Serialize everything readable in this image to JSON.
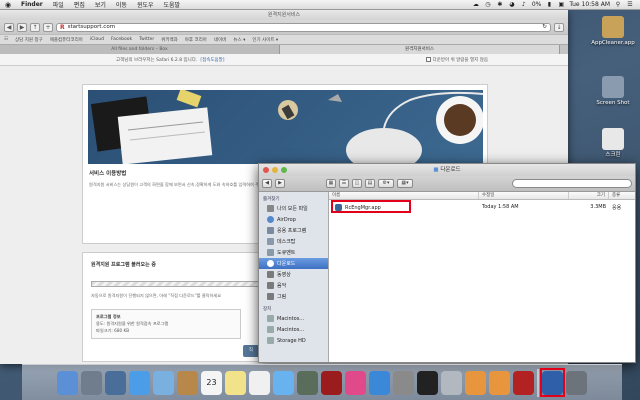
{
  "menubar": {
    "apple": "",
    "items": [
      "Finder",
      "파일",
      "편집",
      "보기",
      "이동",
      "윈도우",
      "도움말"
    ],
    "battery": "0%",
    "clock": "Tue 10:58 AM"
  },
  "safari": {
    "window_title": "원격지원서비스",
    "url": "startsupport.com",
    "bookmarks": [
      "상담 지원 창구",
      "애플컴퓨터코리아",
      "iCloud",
      "Facebook",
      "Twitter",
      "위키백과",
      "야후 코리아",
      "네이버",
      "뉴스 ▾",
      "인기 사이트 ▾"
    ],
    "tabs": [
      {
        "label": "All files and folders – Box",
        "active": false
      },
      {
        "label": "원격지원서비스",
        "active": true
      }
    ],
    "notice": {
      "text": "고객님의 브라우저는 Safari 6.2.8 입니다.",
      "link": "[접속도움말]",
      "checkbox": "다운받아 위 알람을 열지 않음"
    },
    "card1": {
      "title": "서비스 이용방법",
      "text": "원격지원 서비스는 상담원이 고객의 화면을 함께 보면서 신속,정확하게 도와 속하호를 입력하여 주십시오."
    },
    "card2": {
      "title": "원격지원 프로그램 불러오는 중",
      "text": "자동으로 원격지원이 진행되지 않으면, 아래 \"직접 다운로드\"를 클릭하세요",
      "info_title": "프로그램 정보",
      "info_line1": "용도: 원격지원을 위한 원격접속 프로그램",
      "info_line2": "파일크기: 680 KB",
      "button": "직"
    }
  },
  "desktop_icons": [
    {
      "label": "AppCleaner.app",
      "color": "#c9a25a"
    },
    {
      "label": "Screen Shot",
      "color": "#8a9bb0"
    },
    {
      "label": "스크린",
      "color": "#e8e8e8"
    }
  ],
  "finder": {
    "title": "다운로드",
    "search_placeholder": "",
    "sidebar_favorites_head": "즐겨찾기",
    "sidebar_favorites": [
      {
        "label": "나의 모든 파일",
        "color": "#888"
      },
      {
        "label": "AirDrop",
        "color": "#5588cc"
      },
      {
        "label": "응용 프로그램",
        "color": "#7a8aa0"
      },
      {
        "label": "데스크탑",
        "color": "#8899aa"
      },
      {
        "label": "도큐멘트",
        "color": "#8899aa"
      },
      {
        "label": "다운로드",
        "color": "#ffffff",
        "selected": true
      },
      {
        "label": "동영상",
        "color": "#7a7a7a"
      },
      {
        "label": "음악",
        "color": "#7a7a7a"
      },
      {
        "label": "그림",
        "color": "#7a7a7a"
      }
    ],
    "sidebar_devices_head": "장치",
    "sidebar_devices": [
      {
        "label": "Macintos..."
      },
      {
        "label": "Macintos..."
      },
      {
        "label": "Storage HD"
      }
    ],
    "columns": {
      "name": "이름",
      "date": "수정일",
      "size": "크기",
      "kind": "종류"
    },
    "files": [
      {
        "name": "RcEngMgr.app",
        "date": "Today 1:58 AM",
        "size": "3.3MB",
        "kind": "응용"
      }
    ]
  },
  "dock": {
    "items": [
      {
        "name": "finder",
        "color": "#5b8fd6"
      },
      {
        "name": "launchpad",
        "color": "#6f7d8c"
      },
      {
        "name": "mission-control",
        "color": "#4a6e9a"
      },
      {
        "name": "safari",
        "color": "#4b9de8"
      },
      {
        "name": "mail",
        "color": "#7ab0e0"
      },
      {
        "name": "contacts",
        "color": "#b8884a"
      },
      {
        "name": "calendar",
        "color": "#f5f5f5"
      },
      {
        "name": "notes",
        "color": "#f2e28a"
      },
      {
        "name": "reminders",
        "color": "#f0f0f0"
      },
      {
        "name": "messages",
        "color": "#67b2ef"
      },
      {
        "name": "facetime",
        "color": "#5a6c5a"
      },
      {
        "name": "photo-booth",
        "color": "#9b1c1c"
      },
      {
        "name": "itunes",
        "color": "#e04a8a"
      },
      {
        "name": "app-store",
        "color": "#3b88d8"
      },
      {
        "name": "system-preferences",
        "color": "#8a8a8a"
      },
      {
        "name": "terminal",
        "color": "#222"
      },
      {
        "name": "preview",
        "color": "#b1b8c0"
      },
      {
        "name": "remote-app-1",
        "color": "#e8963e"
      },
      {
        "name": "remote-app-2",
        "color": "#e8963e"
      },
      {
        "name": "flash",
        "color": "#b22222"
      },
      {
        "name": "downloads-stack",
        "color": "#2e5fa8",
        "highlight": true
      },
      {
        "name": "trash",
        "color": "#6d737a"
      }
    ],
    "calendar_day": "23"
  }
}
